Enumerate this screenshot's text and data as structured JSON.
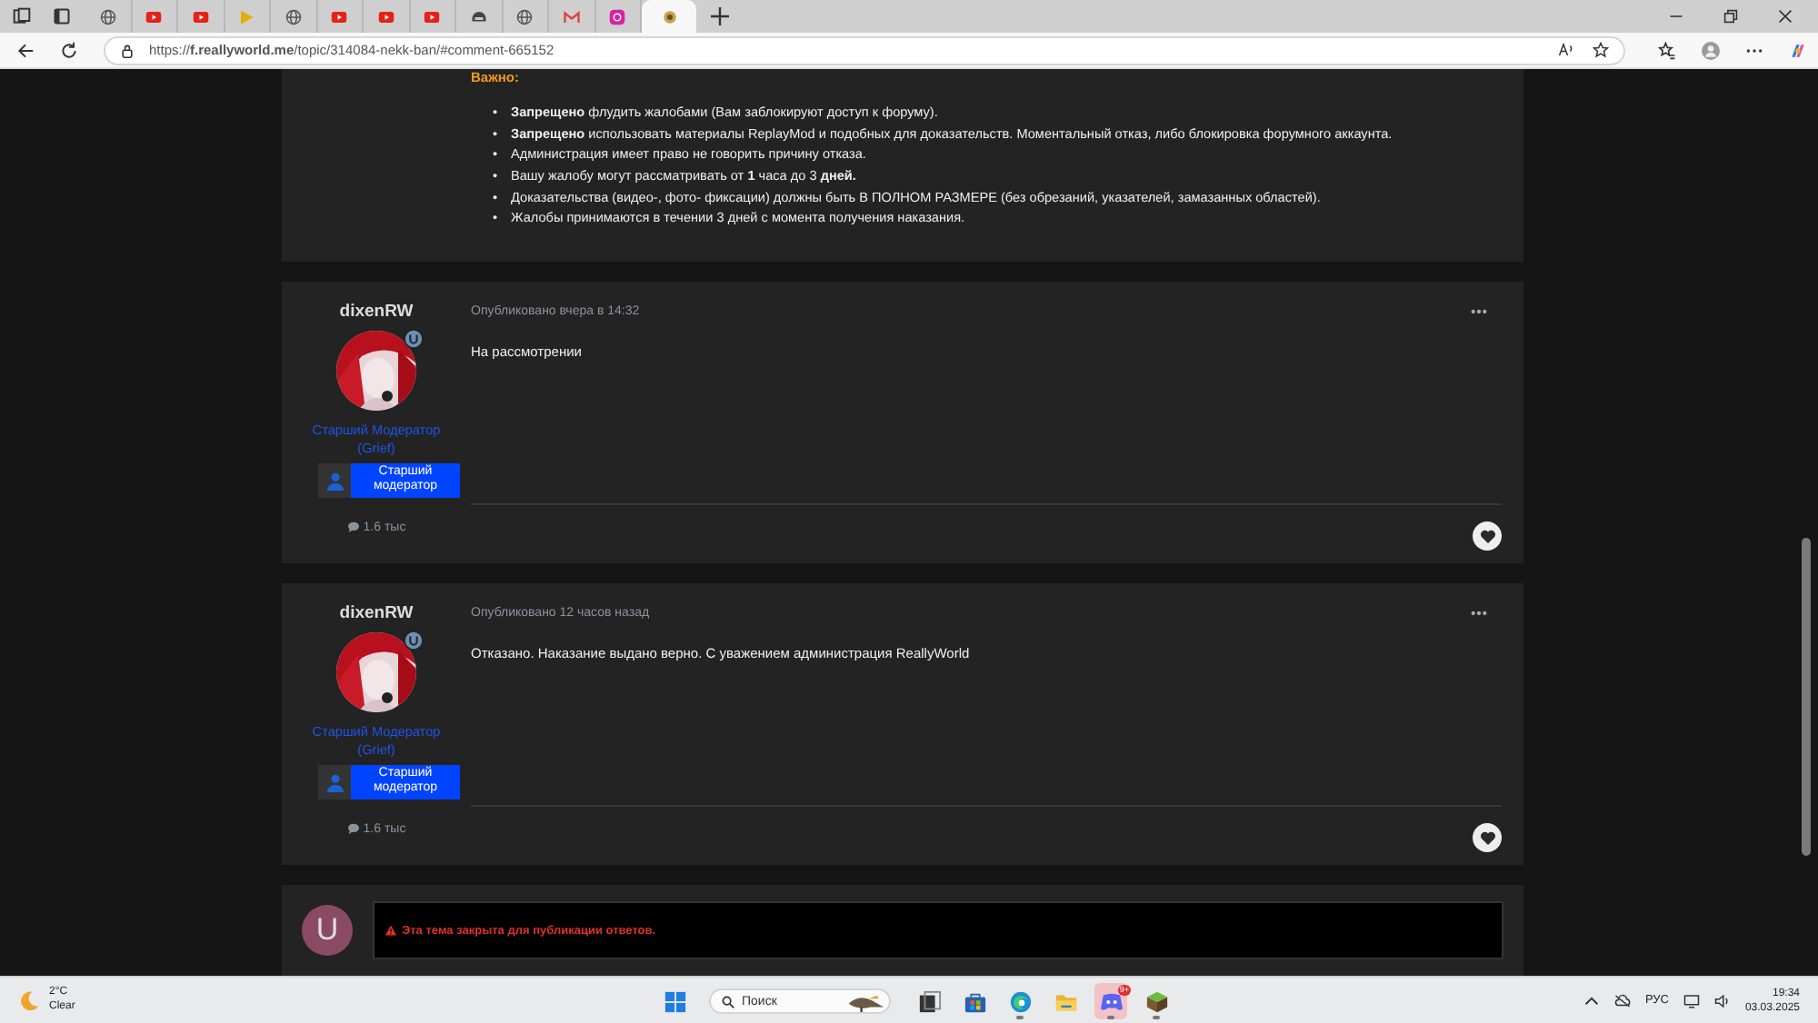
{
  "browser": {
    "tabs": [
      {
        "kind": "globe",
        "selected": false
      },
      {
        "kind": "video",
        "selected": false
      },
      {
        "kind": "video",
        "selected": false
      },
      {
        "kind": "play",
        "selected": false
      },
      {
        "kind": "globe",
        "selected": false
      },
      {
        "kind": "video",
        "selected": false
      },
      {
        "kind": "video",
        "selected": false
      },
      {
        "kind": "video",
        "selected": false
      },
      {
        "kind": "helmet",
        "selected": false
      },
      {
        "kind": "globe",
        "selected": false
      },
      {
        "kind": "mail",
        "selected": false
      },
      {
        "kind": "camera",
        "selected": false
      },
      {
        "kind": "site",
        "selected": true
      }
    ],
    "url": "https://**f.reallyworld.me**/topic/314084-nekk-ban/#comment-665152"
  },
  "notice": {
    "heading": "Важно:",
    "rules": [
      {
        "marker": "•",
        "text": "**Запрещено** флудить жалобами (Вам заблокируют доступ к форуму)."
      },
      {
        "marker": "•",
        "text": "**Запрещено** использовать материалы ReplayMod и подобных для доказательств. Моментальный отказ, либо блокировка форумного аккаунта."
      },
      {
        "marker": "•",
        "text": "Администрация имеет право не говорить причину отказа."
      },
      {
        "marker": "•",
        "text": "Вашу жалобу могут рассматривать от **1** часа до 3  **дней.**"
      },
      {
        "marker": "•",
        "text": "Доказательства (видео-, фото- фиксации) должны быть В ПОЛНОМ РАЗМЕРЕ (без обрезаний, указателей, замазанных областей)."
      },
      {
        "marker": "•",
        "text": "Жалобы принимаются в течении 3 дней с момента получения наказания."
      }
    ]
  },
  "posts": [
    {
      "author": "dixenRW",
      "role": "Старший Модератор (Grief)",
      "badge": "Старший модератор",
      "posts_count": "1.6 тыс",
      "published": "Опубликовано вчера в 14:32",
      "body": "На рассмотрении"
    },
    {
      "author": "dixenRW",
      "role": "Старший Модератор (Grief)",
      "badge": "Старший модератор",
      "posts_count": "1.6 тыс",
      "published": "Опубликовано 12 часов назад",
      "body": "Отказано. Наказание выдано верно. С уважением администрация ReallyWorld"
    }
  ],
  "reply": {
    "avatar_letter": "U",
    "message": "Эта тема закрыта для публикации ответов."
  },
  "taskbar": {
    "temperature": "2°C",
    "weather": "Clear",
    "search": {
      "placeholder": "Поиск"
    },
    "apps": [
      {
        "kind": "taskview",
        "running": false,
        "selected": false
      },
      {
        "kind": "store",
        "running": false,
        "selected": false
      },
      {
        "kind": "edge",
        "running": true,
        "selected": false
      },
      {
        "kind": "folder",
        "running": false,
        "selected": false
      },
      {
        "kind": "chat",
        "running": true,
        "selected": true,
        "badge": "9+"
      },
      {
        "kind": "cube",
        "running": true,
        "selected": false
      }
    ],
    "language": "РУС",
    "time": "19:34",
    "date": "03.03.2025"
  }
}
